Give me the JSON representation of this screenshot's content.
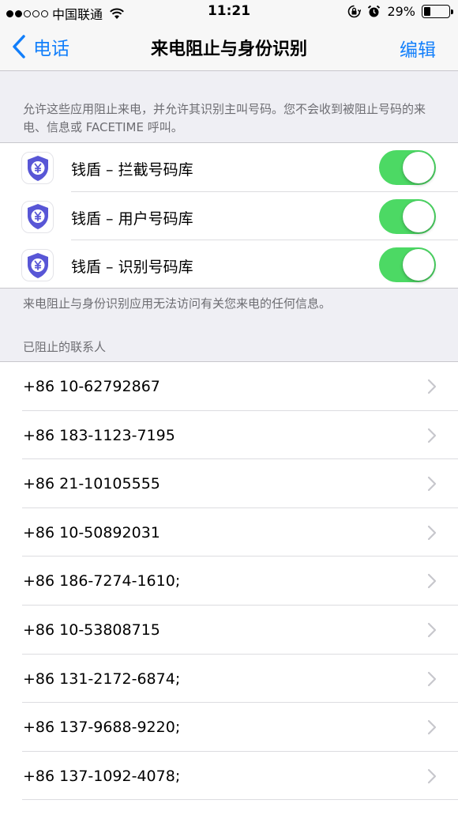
{
  "status_bar": {
    "carrier": "中国联通",
    "time": "11:21",
    "battery_percent": "29%",
    "battery_level": 0.29,
    "signal_strength": 2,
    "signal_max": 5
  },
  "nav": {
    "back_label": "电话",
    "title": "来电阻止与身份识别",
    "edit_label": "编辑"
  },
  "description": "允许这些应用阻止来电，并允许其识别主叫号码。您不会收到被阻止号码的来电、信息或 FACETIME 呼叫。",
  "apps": [
    {
      "label": "钱盾 – 拦截号码库",
      "enabled": true,
      "icon": "shield-yuan-icon"
    },
    {
      "label": "钱盾 – 用户号码库",
      "enabled": true,
      "icon": "shield-yuan-icon"
    },
    {
      "label": "钱盾 – 识别号码库",
      "enabled": true,
      "icon": "shield-yuan-icon"
    }
  ],
  "footer_note": "来电阻止与身份识别应用无法访问有关您来电的任何信息。",
  "blocked_section_header": "已阻止的联系人",
  "blocked_contacts": [
    "+86 10-62792867",
    "+86 183-1123-7195",
    "+86 21-10105555",
    "+86 10-50892031",
    "+86 186-7274-1610;",
    "+86 10-53808715",
    "+86 131-2172-6874;",
    "+86 137-9688-9220;",
    "+86 137-1092-4078;"
  ],
  "colors": {
    "accent": "#127ffb",
    "toggle_on": "#4cd964",
    "shield": "#5856d6",
    "background": "#efeff4"
  }
}
